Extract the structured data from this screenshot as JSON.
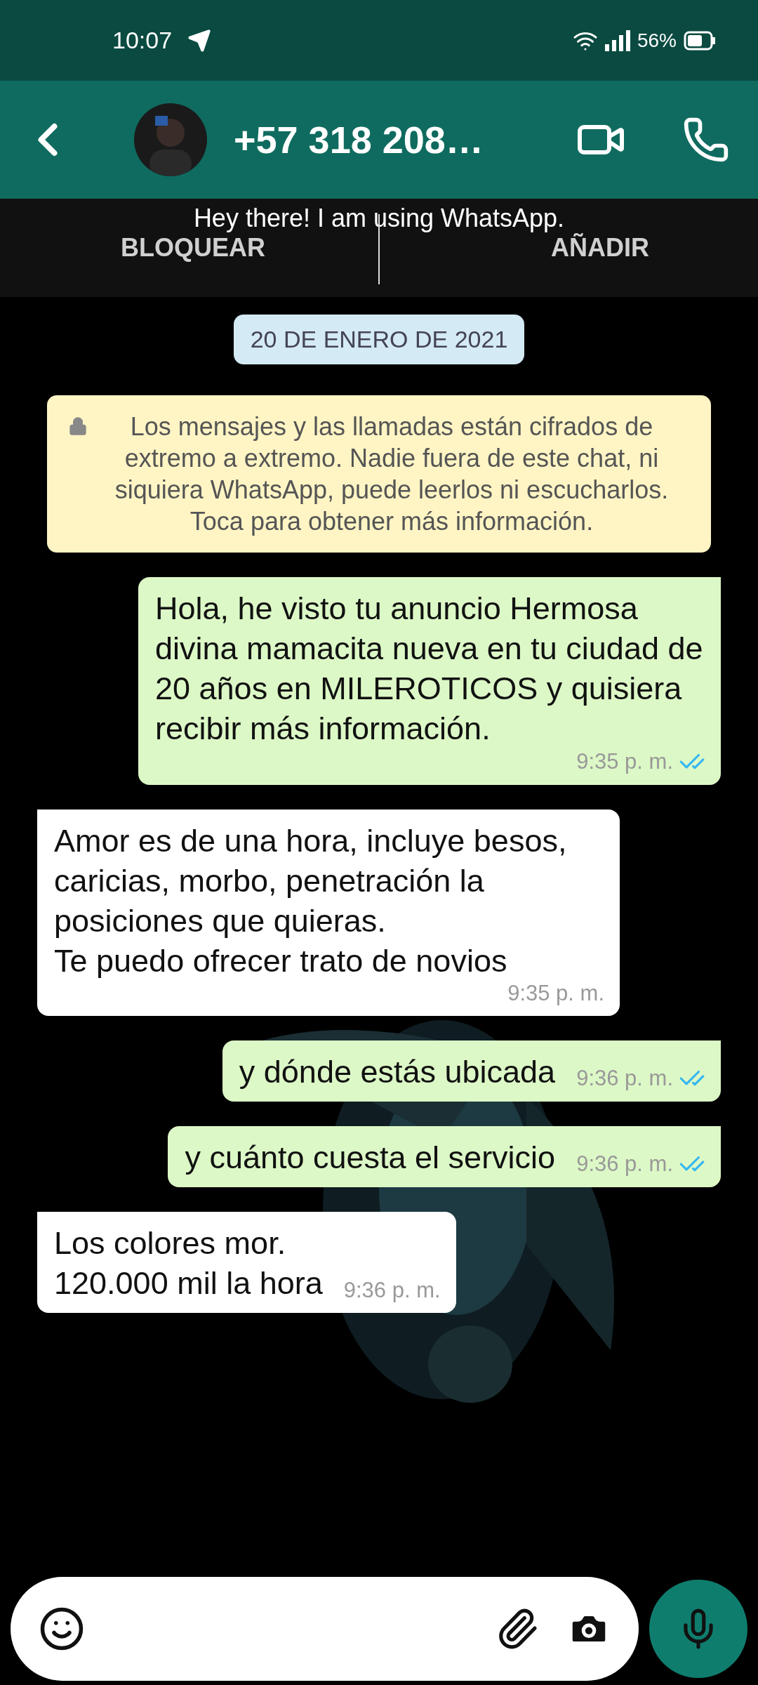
{
  "status_bar": {
    "time": "10:07",
    "battery": "56%"
  },
  "header": {
    "title": "+57 318 208…"
  },
  "about": {
    "status": "Hey there! I am using WhatsApp.",
    "actions": [
      "BLOQUEAR",
      "AÑADIR"
    ]
  },
  "date_chip": "20 DE ENERO DE 2021",
  "encryption_notice": "Los mensajes y las llamadas están cifrados de extremo a extremo. Nadie fuera de este chat, ni siquiera WhatsApp, puede leerlos ni escucharlos. Toca para obtener más información.",
  "messages": [
    {
      "kind": "outgoing",
      "text": "Hola, he visto tu anuncio Hermosa divina mamacita nueva en tu ciudad de 20 años en MILEROTICOS y quisiera recibir más información.",
      "time": "9:35 p. m.",
      "read": true
    },
    {
      "kind": "incoming",
      "text": "Amor es de una hora, incluye besos, caricias, morbo, penetración la posiciones que quieras.\nTe puedo ofrecer trato de novios",
      "time": "9:35 p. m."
    },
    {
      "kind": "outgoing",
      "text": "y dónde estás ubicada",
      "time": "9:36 p. m.",
      "read": true
    },
    {
      "kind": "outgoing",
      "text": "y cuánto cuesta el servicio",
      "time": "9:36 p. m.",
      "read": true
    },
    {
      "kind": "incoming",
      "text": "Los colores mor.\n120.000 mil la hora",
      "time": "9:36 p. m."
    }
  ]
}
